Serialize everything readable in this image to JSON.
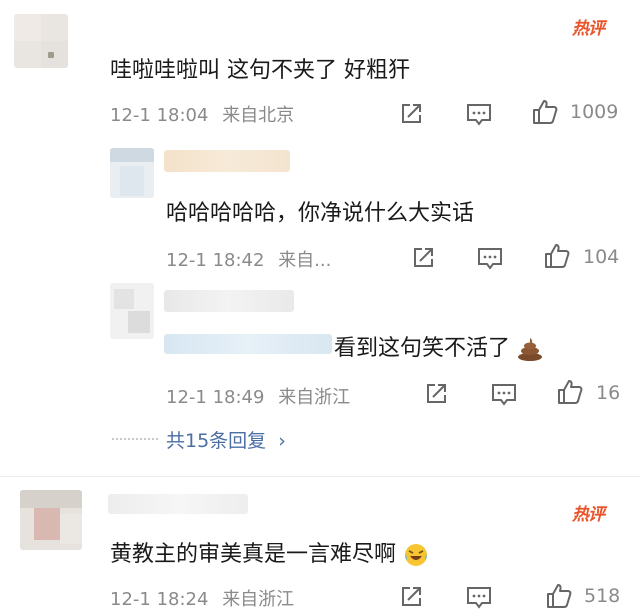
{
  "comments": [
    {
      "badge": "热评",
      "text": "哇啦哇啦叫 这句不夹了 好粗犴",
      "time": "12-1 18:04",
      "location": "来自北京",
      "likes": "1009"
    },
    {
      "text": "哈哈哈哈哈，你净说什么大实话",
      "time": "12-1 18:42",
      "location": "来自...",
      "likes": "104"
    },
    {
      "text": "看到这句笑不活了",
      "emoji": "poop-emoji",
      "time": "12-1 18:49",
      "location": "来自浙江",
      "likes": "16"
    },
    {
      "badge": "热评",
      "text": "黄教主的审美真是一言难尽啊",
      "emoji": "laughing-crying-emoji",
      "time": "12-1 18:24",
      "location": "来自浙江",
      "likes": "518"
    }
  ],
  "replies": {
    "label": "共15条回复",
    "arrow": "›"
  },
  "icons": [
    "share-icon",
    "comment-icon",
    "like-icon"
  ],
  "colors": {
    "hot_badge": "#e8552b",
    "link": "#4a6ea3",
    "meta": "#8a8a8a"
  }
}
